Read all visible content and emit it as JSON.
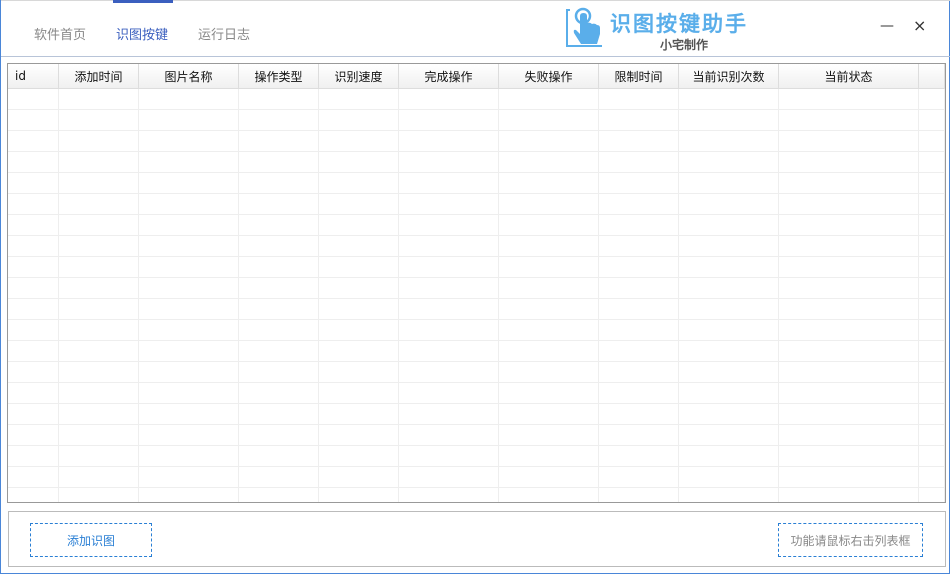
{
  "tabs": [
    {
      "label": "软件首页"
    },
    {
      "label": "识图按键"
    },
    {
      "label": "运行日志"
    }
  ],
  "logo": {
    "title": "识图按键助手",
    "subtitle": "小宅制作"
  },
  "window": {
    "minimize": "—",
    "close": "×"
  },
  "table": {
    "columns": [
      "id",
      "添加时间",
      "图片名称",
      "操作类型",
      "识别速度",
      "完成操作",
      "失败操作",
      "限制时间",
      "当前识别次数",
      "当前状态",
      ""
    ],
    "rows": []
  },
  "buttons": {
    "add": "添加识图",
    "hint": "功能请鼠标右击列表框"
  },
  "colors": {
    "accent": "#3b5fbf",
    "logo": "#5aaeea",
    "dashed": "#2a7fd4"
  }
}
